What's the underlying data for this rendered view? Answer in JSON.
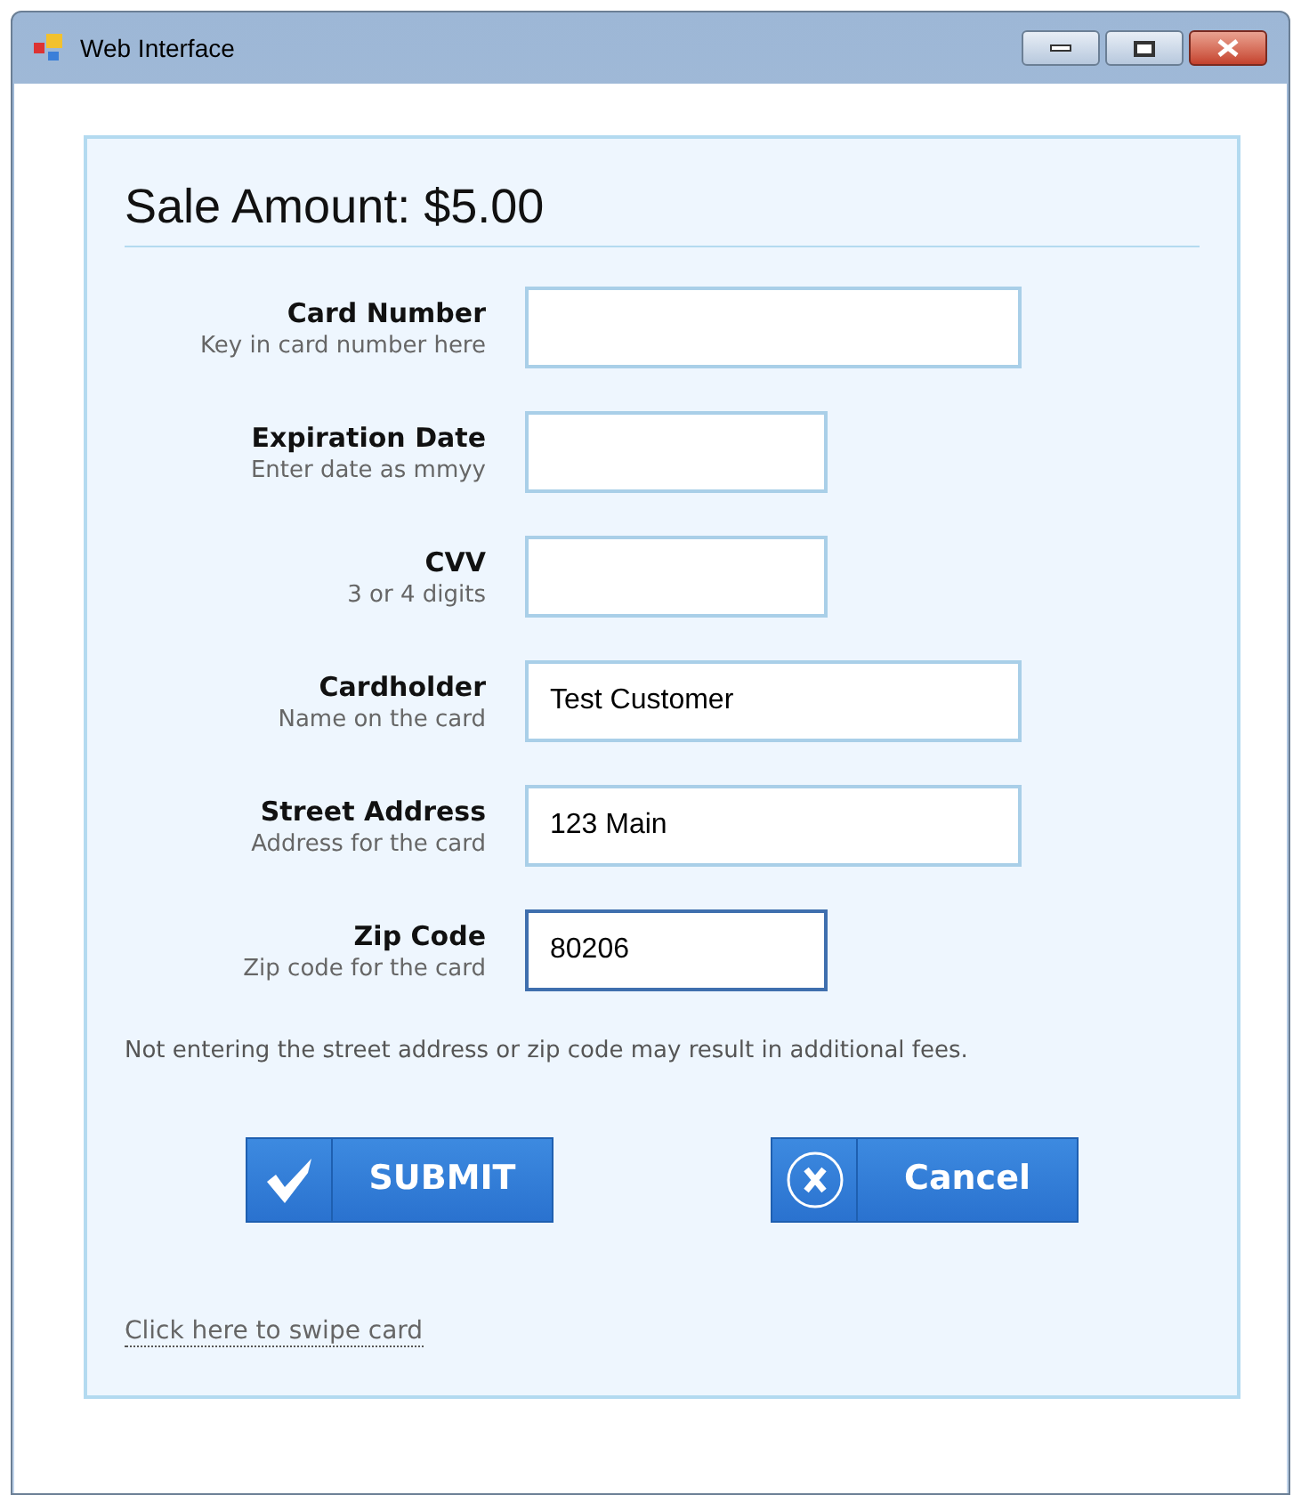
{
  "window": {
    "title": "Web Interface"
  },
  "heading": "Sale Amount: $5.00",
  "fields": [
    {
      "label": "Card Number",
      "hint": "Key in card number here",
      "kind": "long",
      "focused": false
    },
    {
      "label": "Expiration Date",
      "hint": "Enter date as mmyy",
      "kind": "short",
      "focused": false
    },
    {
      "label": "CVV",
      "hint": "3 or 4 digits",
      "kind": "short",
      "focused": false
    },
    {
      "label": "Cardholder",
      "hint": "Name on the card",
      "value": "Test Customer",
      "kind": "long",
      "focused": false
    },
    {
      "label": "Street Address",
      "hint": "Address for the card",
      "value": "123 Main",
      "kind": "long",
      "focused": false
    },
    {
      "label": "Zip Code",
      "hint": "Zip code for the card",
      "value": "80206",
      "kind": "short",
      "focused": true
    }
  ],
  "notice": "Not entering the street address or zip code may result in additional fees.",
  "buttons": [
    {
      "label": "SUBMIT",
      "kind": "submit"
    },
    {
      "label": "Cancel",
      "kind": "cancel"
    }
  ],
  "swipe_link": "Click here to swipe card"
}
